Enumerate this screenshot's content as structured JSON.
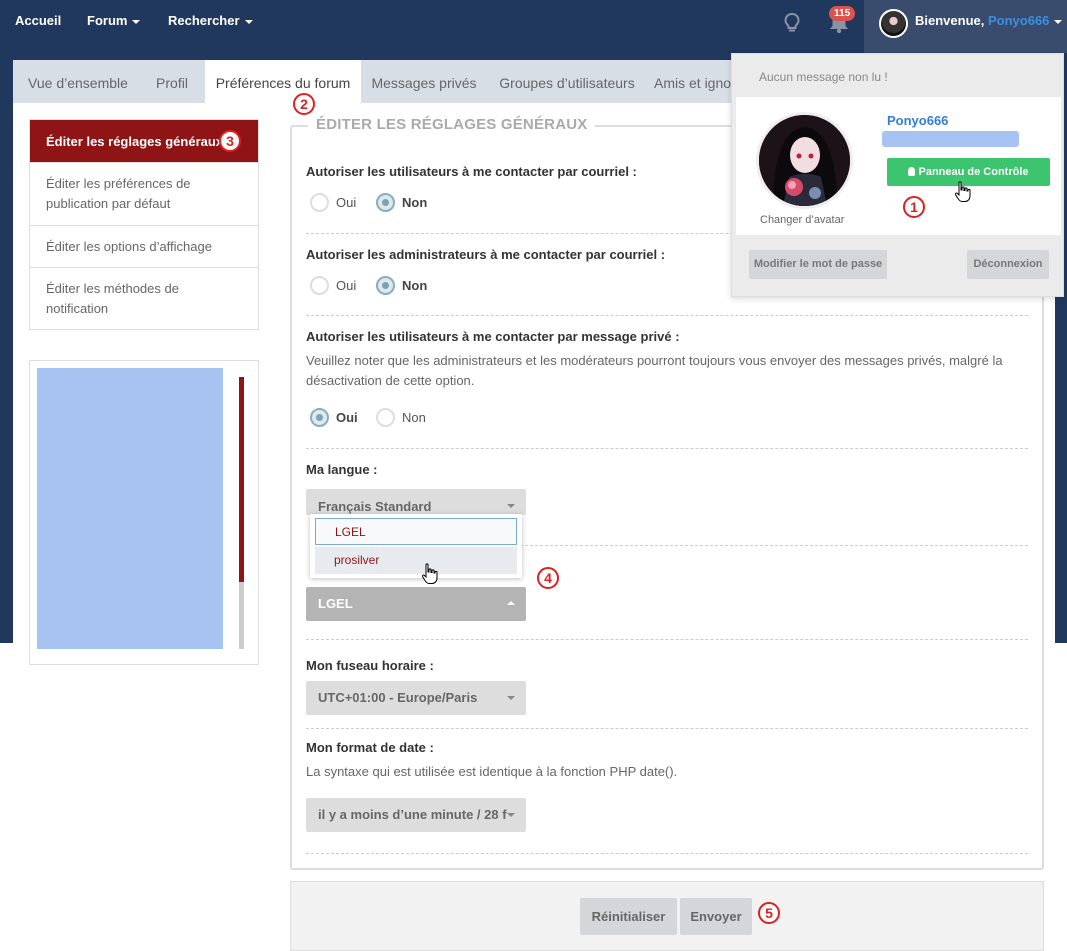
{
  "navbar": {
    "home": "Accueil",
    "forum": "Forum",
    "search": "Rechercher",
    "notification_count": "115",
    "welcome": "Bienvenue,",
    "username": "Ponyo666"
  },
  "tabs": [
    {
      "label": "Vue d’ensemble"
    },
    {
      "label": "Profil"
    },
    {
      "label": "Préférences du forum"
    },
    {
      "label": "Messages privés"
    },
    {
      "label": "Groupes d’utilisateurs"
    },
    {
      "label": "Amis et igno"
    }
  ],
  "steps": [
    "1",
    "2",
    "3",
    "4",
    "5"
  ],
  "sidebar": {
    "items": [
      {
        "label": "Éditer les réglages généraux"
      },
      {
        "label": "Éditer les préférences de publication par défaut"
      },
      {
        "label": "Éditer les options d’affichage"
      },
      {
        "label": "Éditer les méthodes de notification"
      }
    ]
  },
  "form": {
    "legend": "ÉDITER LES RÉGLAGES GÉNÉRAUX",
    "email_users": {
      "label": "Autoriser les utilisateurs à me contacter par courriel :",
      "yes": "Oui",
      "no": "Non",
      "selected": "Non"
    },
    "email_admins": {
      "label": "Autoriser les administrateurs à me contacter par courriel :",
      "yes": "Oui",
      "no": "Non",
      "selected": "Non"
    },
    "pm_users": {
      "label": "Autoriser les utilisateurs à me contacter par message privé :",
      "note": "Veuillez noter que les administrateurs et les modérateurs pourront toujours vous envoyer des messages privés, malgré la désactivation de cette option.",
      "yes": "Oui",
      "no": "Non",
      "selected": "Oui"
    },
    "language": {
      "label": "Ma langue :",
      "value": "Français Standard",
      "options": [
        "LGEL",
        "prosilver"
      ]
    },
    "style_select": {
      "value": "LGEL"
    },
    "timezone": {
      "label": "Mon fuseau horaire :",
      "value": "UTC+01:00 - Europe/Paris"
    },
    "date_format": {
      "label": "Mon format de date :",
      "note": "La syntaxe qui est utilisée est identique à la fonction PHP date().",
      "value": "il y a moins d’une minute / 28 f"
    }
  },
  "buttons": {
    "reset": "Réinitialiser",
    "submit": "Envoyer"
  },
  "user_panel": {
    "no_messages": "Aucun message non lu !",
    "username": "Ponyo666",
    "control_panel": "Panneau de Contrôle",
    "change_avatar": "Changer d’avatar",
    "change_password": "Modifier le mot de passe",
    "logout": "Déconnexion"
  },
  "colors": {
    "navbar": "#20385e",
    "accent": "#8e1416",
    "green": "#3cc46e",
    "step": "#e0201e"
  }
}
